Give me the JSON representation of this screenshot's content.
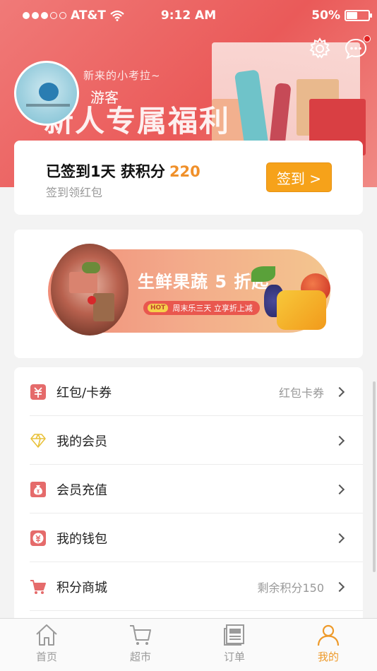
{
  "status_bar": {
    "carrier": "AT&T",
    "time": "9:12 AM",
    "battery": "50%",
    "battery_level": 0.5
  },
  "header": {
    "banner_subtitle": "新来的小考拉~",
    "banner_title": "新人专属福利",
    "username": "游客"
  },
  "checkin": {
    "title": "已签到1天 获积分",
    "points": "220",
    "subtitle": "签到领红包",
    "button_label": "签到 >"
  },
  "promo": {
    "title": "生鲜果蔬 5 折起",
    "hot_badge": "HOT",
    "tag_text": "周末乐三天 立享折上减"
  },
  "menu": {
    "items": [
      {
        "label": "红包/卡券",
        "value": "红包卡券",
        "icon": "red-envelope-icon"
      },
      {
        "label": "我的会员",
        "value": "",
        "icon": "diamond-icon"
      },
      {
        "label": "会员充值",
        "value": "",
        "icon": "money-bag-icon"
      },
      {
        "label": "我的钱包",
        "value": "",
        "icon": "wallet-icon"
      },
      {
        "label": "积分商城",
        "value": "剩余积分150",
        "icon": "cart-icon"
      }
    ]
  },
  "tabbar": {
    "tabs": [
      {
        "label": "首页",
        "icon": "home-icon",
        "active": false
      },
      {
        "label": "超市",
        "icon": "cart-icon",
        "active": false
      },
      {
        "label": "订单",
        "icon": "order-list-icon",
        "active": false
      },
      {
        "label": "我的",
        "icon": "person-icon",
        "active": true
      }
    ]
  },
  "colors": {
    "header_red": "#ea5a59",
    "points_orange": "#f0902a",
    "checkin_button": "#f6a21a",
    "active_tab": "#ee9a2a",
    "icon_red": "#e56b6b"
  }
}
